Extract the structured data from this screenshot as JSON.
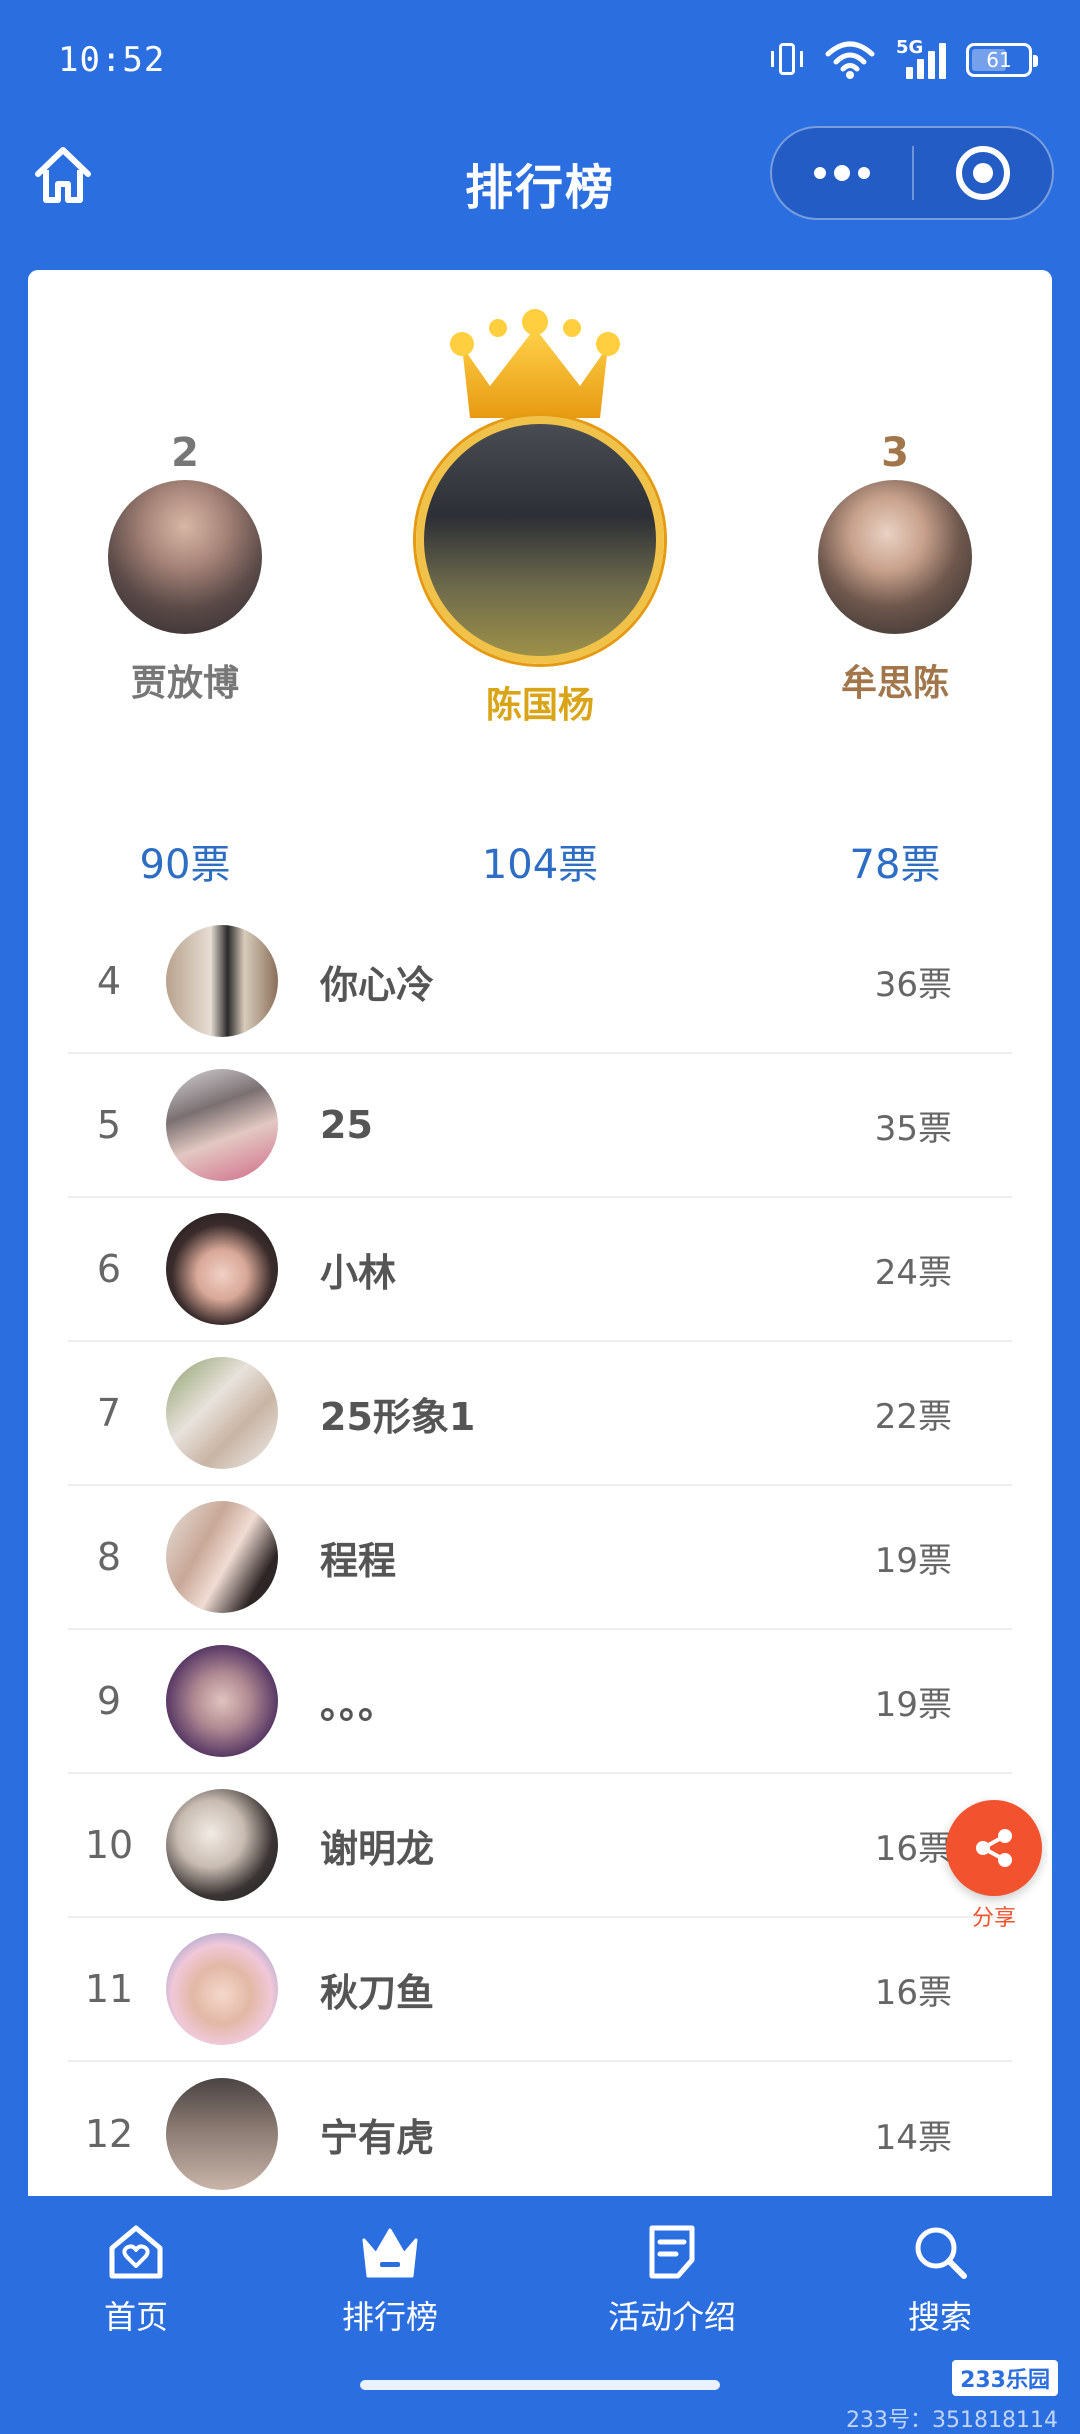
{
  "status_bar": {
    "time": "10:52",
    "network": "5G",
    "battery": "61"
  },
  "nav": {
    "title": "排行榜"
  },
  "colors": {
    "primary": "#2b6ee0",
    "gold": "#e4ae22",
    "silver": "#777777",
    "bronze": "#a0764a",
    "vote_blue": "#2d6dc4",
    "share": "#f2522e"
  },
  "podium": [
    {
      "rank": "2",
      "name": "贾放博",
      "votes": "90票",
      "avatar": "avatar-photo"
    },
    {
      "rank": "1",
      "name": "陈国杨",
      "votes": "104票",
      "avatar": "avatar-photo"
    },
    {
      "rank": "3",
      "name": "牟思陈",
      "votes": "78票",
      "avatar": "avatar-photo"
    }
  ],
  "rankings": [
    {
      "rank": "4",
      "name": "你心冷",
      "votes": "36票"
    },
    {
      "rank": "5",
      "name": "25",
      "votes": "35票"
    },
    {
      "rank": "6",
      "name": "小林",
      "votes": "24票"
    },
    {
      "rank": "7",
      "name": "25形象1",
      "votes": "22票"
    },
    {
      "rank": "8",
      "name": "程程",
      "votes": "19票"
    },
    {
      "rank": "9",
      "name": "。。。",
      "votes": "19票"
    },
    {
      "rank": "10",
      "name": "谢明龙",
      "votes": "16票"
    },
    {
      "rank": "11",
      "name": "秋刀鱼",
      "votes": "16票"
    },
    {
      "rank": "12",
      "name": "宁有虎",
      "votes": "14票"
    }
  ],
  "share": {
    "label": "分享"
  },
  "tabs": [
    {
      "label": "首页",
      "icon": "home-heart-icon"
    },
    {
      "label": "排行榜",
      "icon": "crown-icon",
      "active": true
    },
    {
      "label": "活动介绍",
      "icon": "document-icon"
    },
    {
      "label": "搜索",
      "icon": "search-icon"
    }
  ],
  "watermark": {
    "brand": "233乐园",
    "text": "233号：351818114"
  }
}
